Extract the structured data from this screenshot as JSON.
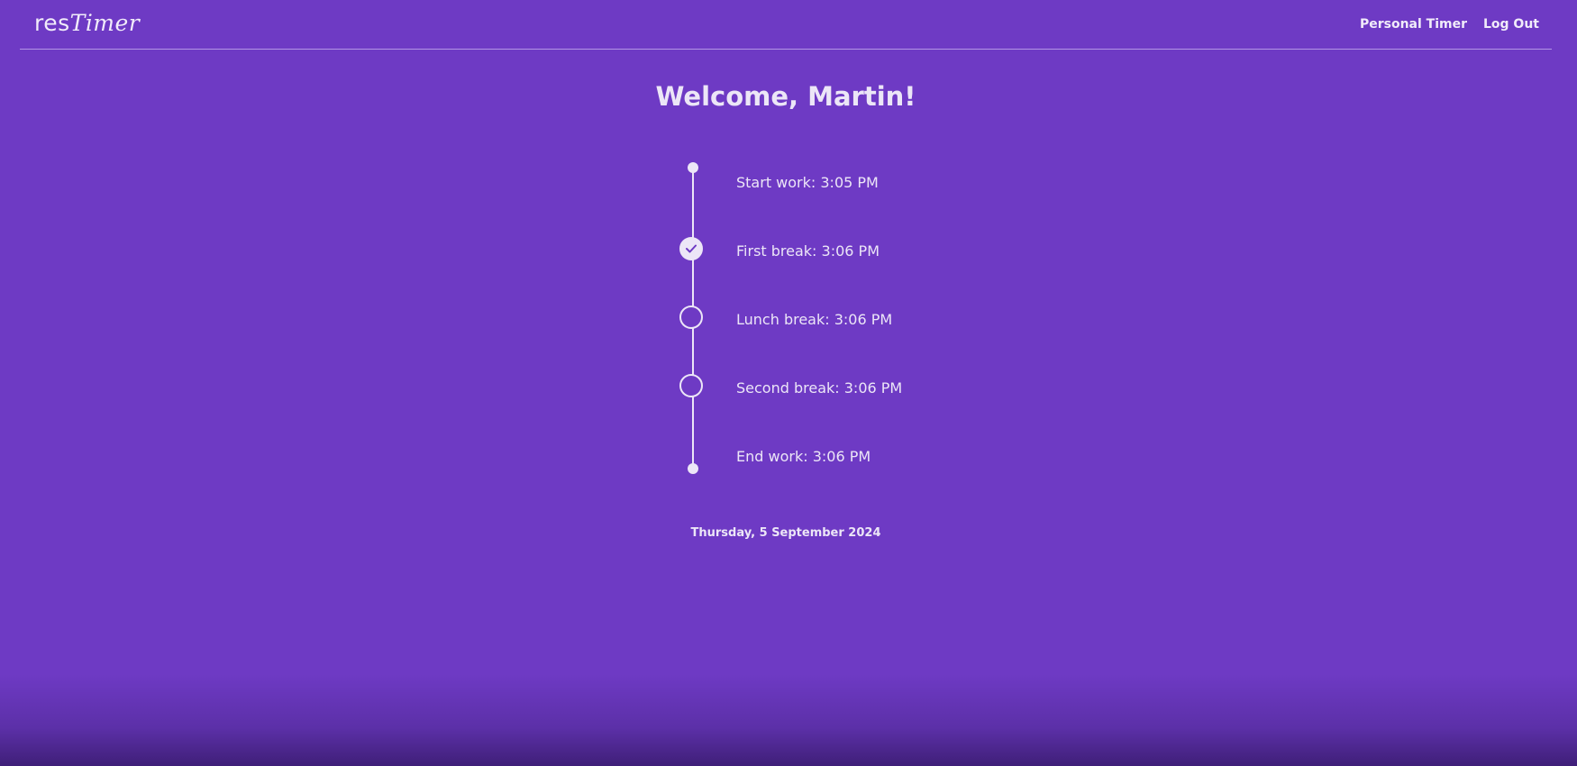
{
  "header": {
    "brand_prefix": "res",
    "brand_suffix": "Timer",
    "nav": [
      {
        "label": "Personal Timer"
      },
      {
        "label": "Log Out"
      }
    ]
  },
  "welcome": "Welcome, Martin!",
  "timeline": [
    {
      "label": "Start work: 3:05 PM",
      "marker": "dot"
    },
    {
      "label": "First break: 3:06 PM",
      "marker": "check-circle",
      "done": true
    },
    {
      "label": "Lunch break: 3:06 PM",
      "marker": "circle",
      "done": false
    },
    {
      "label": "Second break: 3:06 PM",
      "marker": "circle",
      "done": false
    },
    {
      "label": "End work: 3:06 PM",
      "marker": "dot"
    }
  ],
  "date": "Thursday, 5 September 2024",
  "colors": {
    "background": "#6e3ac4",
    "foreground": "#ece6f7"
  }
}
